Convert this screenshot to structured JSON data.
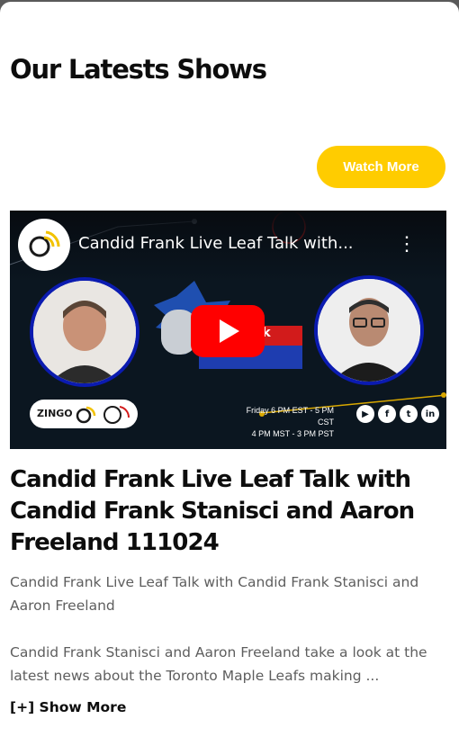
{
  "section": {
    "title": "Our Latests Shows"
  },
  "watch_more": {
    "label": "Watch More",
    "color": "#ffcc00"
  },
  "video": {
    "title": "Candid Frank Live Leaf Talk with...",
    "brand_text": "rank",
    "brand_subtitle": "Leafs Talk Edition",
    "schedule": [
      "Friday 6 PM EST - 5 PM CST",
      "4 PM MST - 3 PM PST"
    ],
    "logo_text": "ZINGO",
    "socials": [
      "youtube-icon",
      "facebook-icon",
      "twitter-icon",
      "linkedin-icon"
    ]
  },
  "show": {
    "title": "Candid Frank Live Leaf Talk with Candid Frank Stanisci and Aaron Freeland 111024",
    "description_1": "Candid Frank Live Leaf Talk with Candid Frank Stanisci and Aaron Freeland",
    "description_2": "Candid Frank Stanisci and Aaron Freeland take a look at the latest news about the Toronto Maple Leafs making ...",
    "show_more": "[+] Show More"
  }
}
